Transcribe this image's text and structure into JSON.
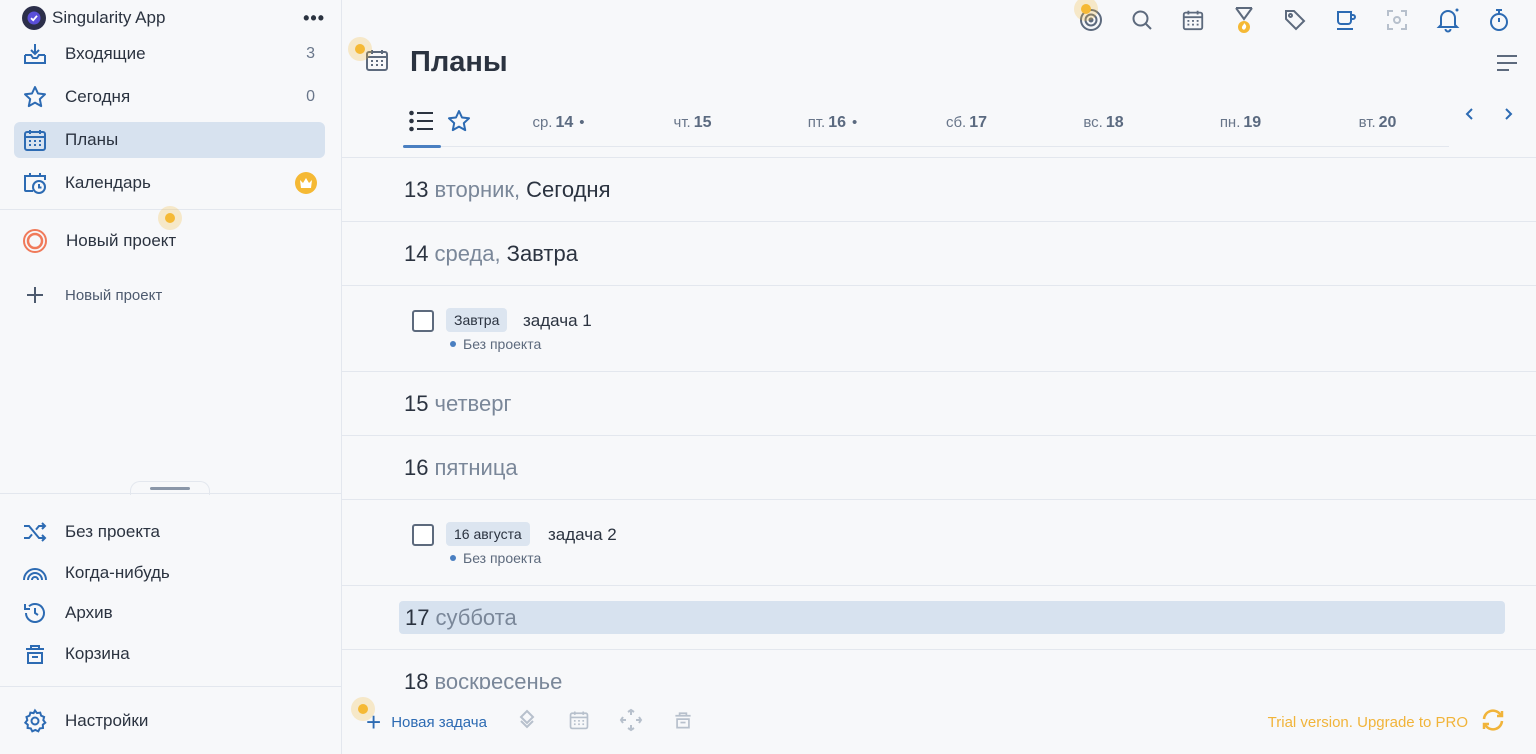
{
  "app": {
    "name": "Singularity App",
    "more_label": "•••"
  },
  "sidebar": {
    "items": [
      {
        "label": "Входящие",
        "count": "3"
      },
      {
        "label": "Сегодня",
        "count": "0"
      },
      {
        "label": "Планы",
        "count": ""
      },
      {
        "label": "Календарь",
        "count": ""
      }
    ],
    "projects": [
      {
        "label": "Новый проект"
      }
    ],
    "new_project_label": "Новый проект",
    "bottom": [
      {
        "label": "Без проекта"
      },
      {
        "label": "Когда-нибудь"
      },
      {
        "label": "Архив"
      },
      {
        "label": "Корзина"
      }
    ],
    "settings_label": "Настройки"
  },
  "main": {
    "title": "Планы",
    "strip": [
      {
        "wd": "ср.",
        "num": "14",
        "dot": "•"
      },
      {
        "wd": "чт.",
        "num": "15",
        "dot": ""
      },
      {
        "wd": "пт.",
        "num": "16",
        "dot": "•"
      },
      {
        "wd": "сб.",
        "num": "17",
        "dot": ""
      },
      {
        "wd": "вс.",
        "num": "18",
        "dot": ""
      },
      {
        "wd": "пн.",
        "num": "19",
        "dot": ""
      },
      {
        "wd": "вт.",
        "num": "20",
        "dot": ""
      }
    ],
    "days": [
      {
        "num": "13",
        "weekday": "вторник,",
        "rel": "Сегодня"
      },
      {
        "num": "14",
        "weekday": "среда,",
        "rel": "Завтра"
      },
      {
        "num": "15",
        "weekday": "четверг",
        "rel": ""
      },
      {
        "num": "16",
        "weekday": "пятница",
        "rel": ""
      },
      {
        "num": "17",
        "weekday": "суббота",
        "rel": ""
      },
      {
        "num": "18",
        "weekday": "воскресенье",
        "rel": ""
      }
    ],
    "tasks": [
      {
        "tag": "Завтра",
        "name": "задача 1",
        "project": "Без проекта"
      },
      {
        "tag": "16 августа",
        "name": "задача 2",
        "project": "Без проекта"
      }
    ]
  },
  "footer": {
    "new_task_label": "Новая задача",
    "trial_label": "Trial version. Upgrade to PRO"
  },
  "colors": {
    "accent": "#4a7fc1",
    "highlight": "#d7e2ef",
    "premium": "#f5b935"
  }
}
